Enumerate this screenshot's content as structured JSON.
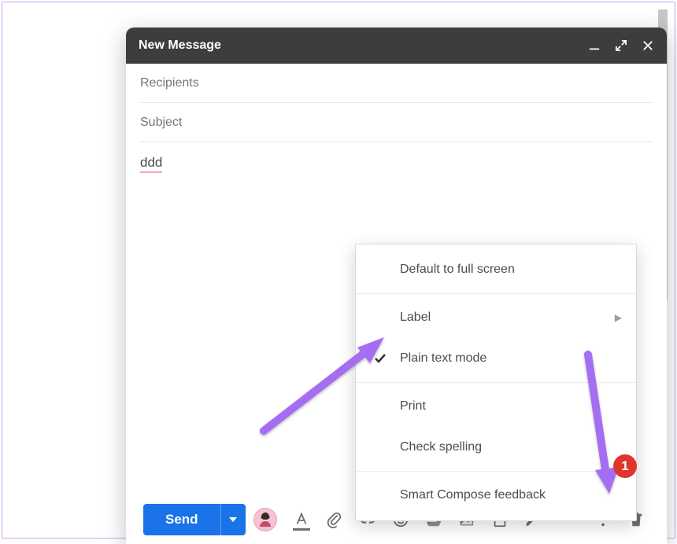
{
  "window": {
    "title": "New Message",
    "recipients_placeholder": "Recipients",
    "subject_placeholder": "Subject",
    "body_text": "ddd"
  },
  "toolbar": {
    "send_label": "Send"
  },
  "menu": {
    "default_fullscreen": "Default to full screen",
    "label": "Label",
    "plain_text": "Plain text mode",
    "print": "Print",
    "check_spelling": "Check spelling",
    "smart_compose": "Smart Compose feedback"
  },
  "annotations": {
    "badge_number": "1"
  }
}
